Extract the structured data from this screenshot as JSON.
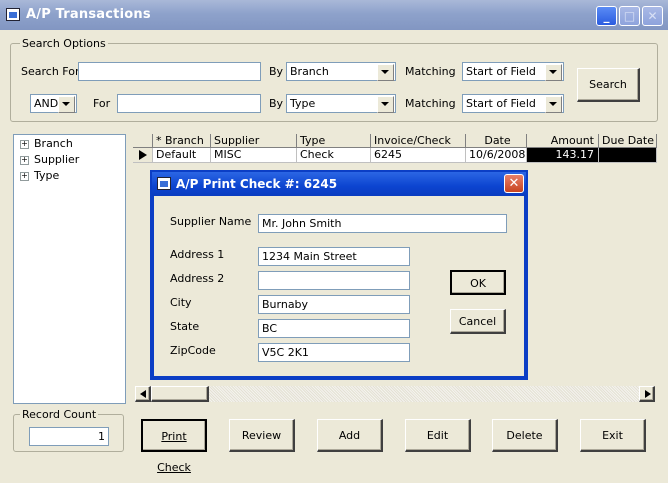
{
  "window": {
    "title": "A/P Transactions"
  },
  "search": {
    "group_label": "Search Options",
    "search_for_label": "Search For",
    "search_for_value": "",
    "by_label": "By",
    "by1_value": "Branch",
    "matching_label": "Matching",
    "matching1_value": "Start of Field",
    "search_button": "Search",
    "logic_value": "AND",
    "for_label": "For",
    "for_value": "",
    "by2_value": "Type",
    "matching2_value": "Start of Field"
  },
  "tree": {
    "items": [
      {
        "label": "Branch"
      },
      {
        "label": "Supplier"
      },
      {
        "label": "Type"
      }
    ]
  },
  "grid": {
    "columns": [
      "* Branch",
      "Supplier",
      "Type",
      "Invoice/Check",
      "Date",
      "Amount",
      "Due Date"
    ],
    "rows": [
      {
        "branch": "Default",
        "supplier": "MISC",
        "type": "Check",
        "invoice": "6245",
        "date": "10/6/2008",
        "amount": "143.17",
        "due": ""
      }
    ]
  },
  "record_count": {
    "label": "Record Count",
    "value": "1"
  },
  "buttons": {
    "print_check": "Print Check",
    "review": "Review",
    "add": "Add",
    "edit": "Edit",
    "delete": "Delete",
    "exit": "Exit"
  },
  "dialog": {
    "title": "A/P Print Check #: 6245",
    "supplier_name_label": "Supplier Name",
    "supplier_name_value": "Mr. John Smith",
    "address1_label": "Address 1",
    "address1_value": "1234 Main Street",
    "address2_label": "Address 2",
    "address2_value": "",
    "city_label": "City",
    "city_value": "Burnaby",
    "state_label": "State",
    "state_value": "BC",
    "zip_label": "ZipCode",
    "zip_value": "V5C 2K1",
    "ok_button": "OK",
    "cancel_button": "Cancel"
  }
}
